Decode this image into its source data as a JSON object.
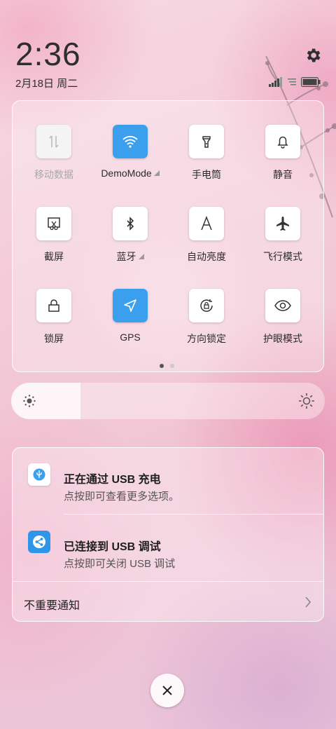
{
  "status_bar": {
    "time": "2:36",
    "date": "2月18日 周二",
    "icons": [
      "signal-icon",
      "wifi-indicator-icon",
      "battery-icon"
    ]
  },
  "quick_settings": {
    "tiles": [
      {
        "label": "移动数据",
        "icon": "mobile-data-icon",
        "state": "disabled"
      },
      {
        "label": "DemoMode",
        "icon": "wifi-icon",
        "state": "on",
        "has_submenu": true
      },
      {
        "label": "手电筒",
        "icon": "flashlight-icon",
        "state": "off"
      },
      {
        "label": "静音",
        "icon": "bell-icon",
        "state": "off"
      },
      {
        "label": "截屏",
        "icon": "screenshot-icon",
        "state": "off"
      },
      {
        "label": "蓝牙",
        "icon": "bluetooth-icon",
        "state": "off",
        "has_submenu": true
      },
      {
        "label": "自动亮度",
        "icon": "auto-brightness-icon",
        "state": "off"
      },
      {
        "label": "飞行模式",
        "icon": "airplane-icon",
        "state": "off"
      },
      {
        "label": "锁屏",
        "icon": "lock-icon",
        "state": "off"
      },
      {
        "label": "GPS",
        "icon": "location-icon",
        "state": "on"
      },
      {
        "label": "方向锁定",
        "icon": "rotation-lock-icon",
        "state": "off"
      },
      {
        "label": "护眼模式",
        "icon": "eye-icon",
        "state": "off"
      }
    ],
    "page_indicator": {
      "current": 1,
      "total": 2
    }
  },
  "brightness": {
    "level": 0.22
  },
  "notifications": {
    "items": [
      {
        "title": "正在通过 USB 充电",
        "subtitle": "点按即可查看更多选项。",
        "icon": "usb-icon"
      },
      {
        "title": "已连接到 USB 调试",
        "subtitle": "点按即可关闭 USB 调试",
        "icon": "share-icon"
      }
    ],
    "unimportant_label": "不重要通知"
  },
  "colors": {
    "accent": "#3aa0ee"
  }
}
